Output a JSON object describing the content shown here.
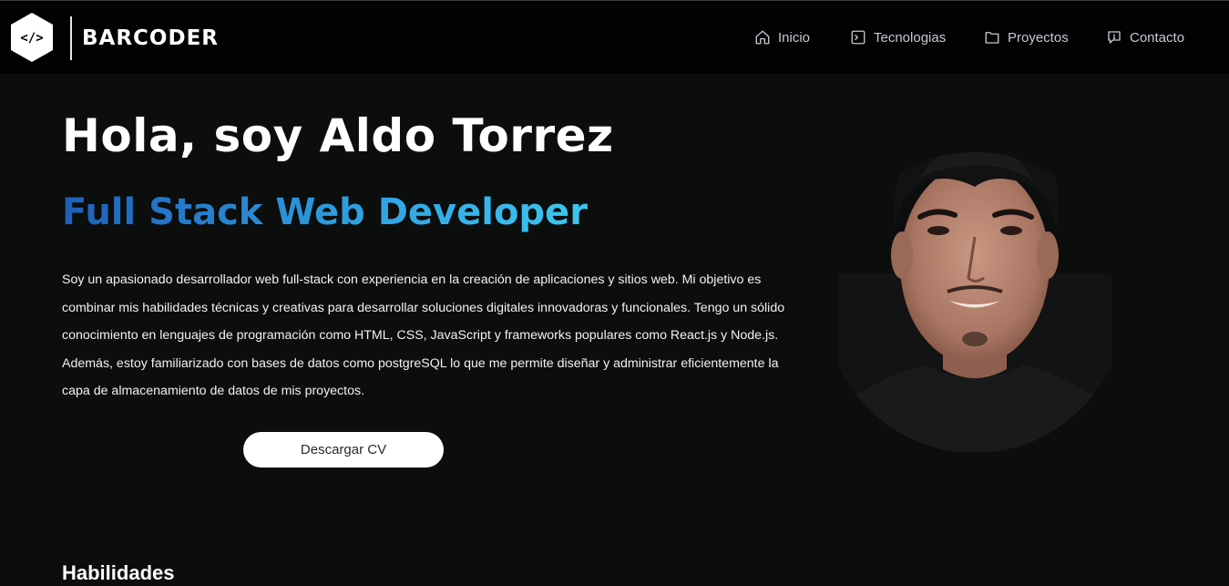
{
  "navbar": {
    "logo_glyph": "</>",
    "brand": "BARCODER",
    "items": [
      {
        "label": "Inicio",
        "icon": "home-icon"
      },
      {
        "label": "Tecnologias",
        "icon": "terminal-icon"
      },
      {
        "label": "Proyectos",
        "icon": "folder-icon"
      },
      {
        "label": "Contacto",
        "icon": "chat-icon"
      }
    ]
  },
  "hero": {
    "title": "Hola, soy Aldo Torrez",
    "subtitle": "Full Stack Web Developer",
    "description": "Soy un apasionado desarrollador web full-stack con experiencia en la creación de aplicaciones y sitios web. Mi objetivo es combinar mis habilidades técnicas y creativas para desarrollar soluciones digitales innovadoras y funcionales. Tengo un sólido conocimiento en lenguajes de programación como HTML, CSS, JavaScript y frameworks populares como React.js y Node.js. Además, estoy familiarizado con bases de datos como postgreSQL lo que me permite diseñar y administrar eficientemente la capa de almacenamiento de datos de mis proyectos.",
    "cv_button": "Descargar CV"
  },
  "skills": {
    "title": "Habilidades"
  },
  "colors": {
    "background": "#0c0d0d",
    "navbar": "#020202",
    "subtitle_gradient_start": "#1e5fb8",
    "subtitle_gradient_end": "#3cc7f0",
    "nav_text": "#c5c9d3"
  }
}
